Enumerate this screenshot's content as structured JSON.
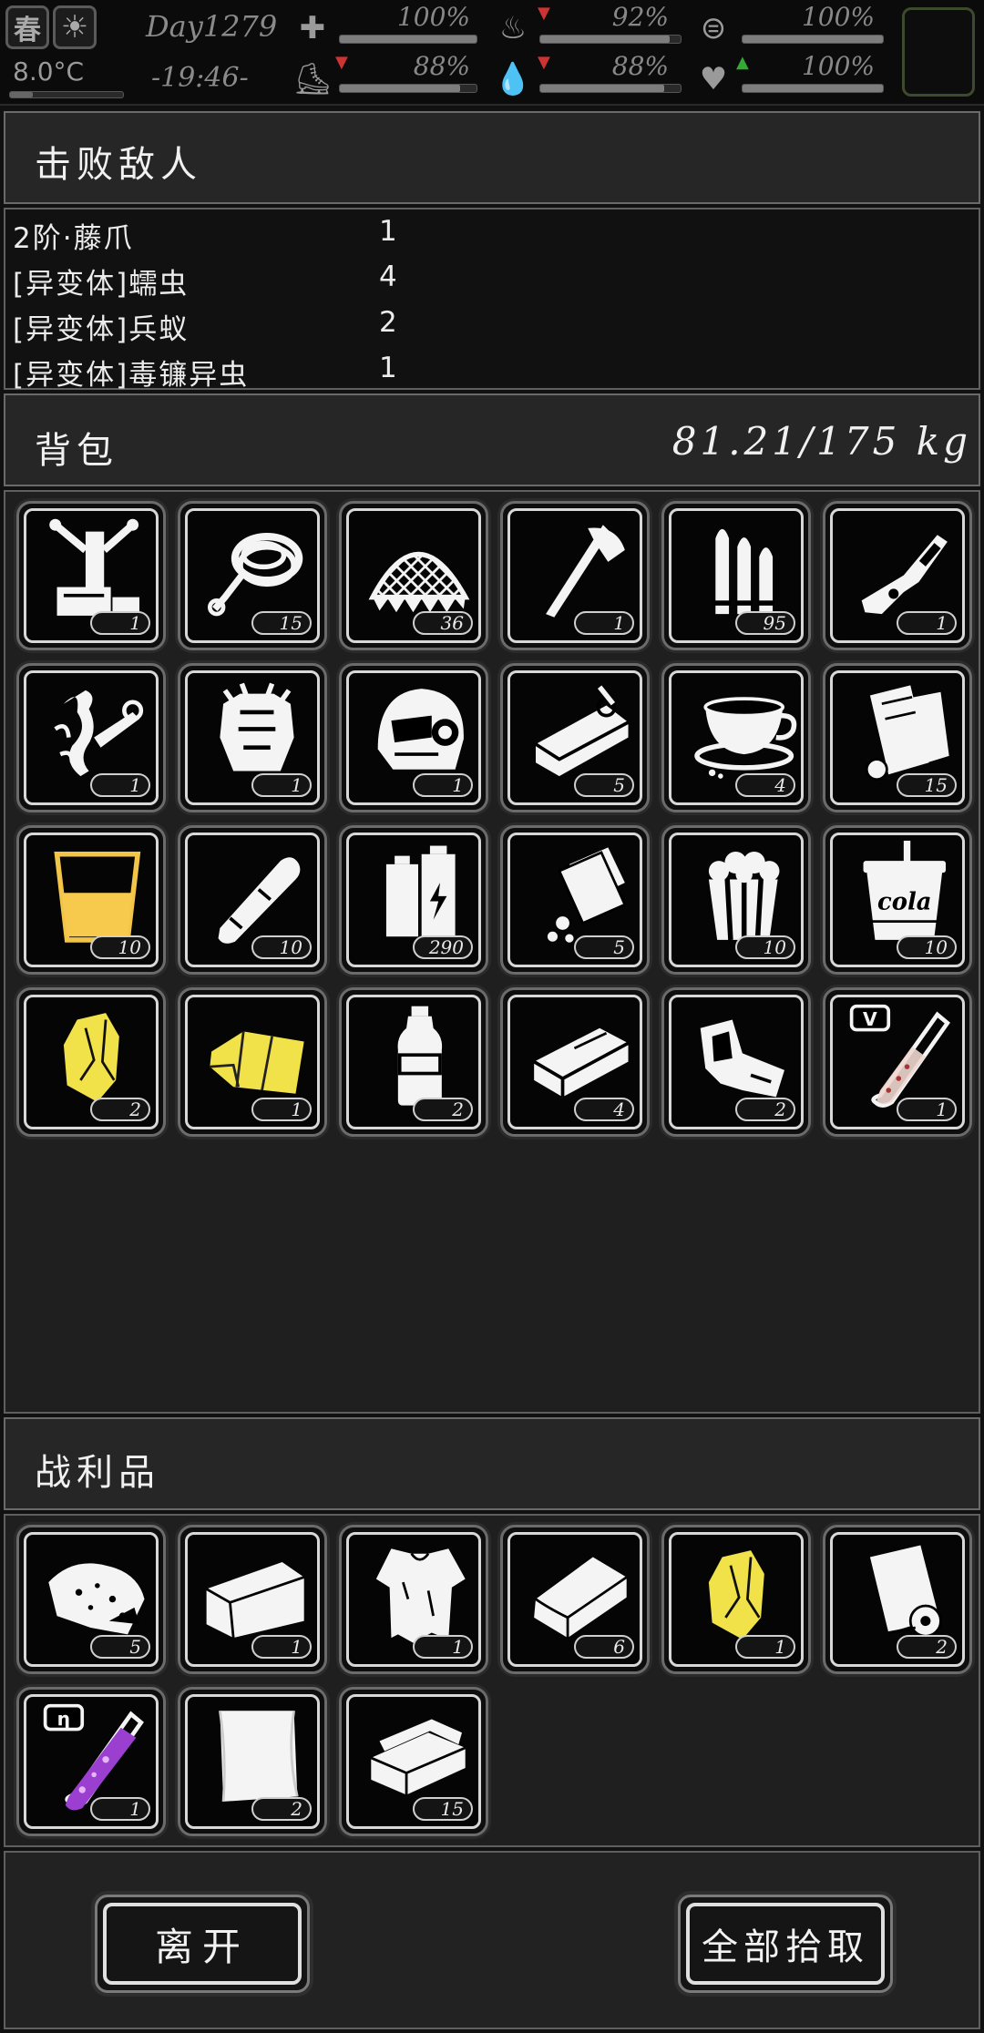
{
  "status": {
    "season": "春",
    "day": "Day1279",
    "temperature": "8.0°C",
    "time": "-19:46-",
    "stats": [
      {
        "icon": "medkit-icon",
        "value": "100%",
        "level": 1.0
      },
      {
        "icon": "stomach-icon",
        "value": "92%",
        "level": 0.92,
        "trend": "down"
      },
      {
        "icon": "stamina-icon",
        "value": "100%",
        "level": 1.0
      },
      {
        "icon": "boot-icon",
        "value": "88%",
        "level": 0.88,
        "trend": "down"
      },
      {
        "icon": "water-drop-icon",
        "value": "88%",
        "level": 0.88,
        "trend": "down"
      },
      {
        "icon": "heart-icon",
        "value": "100%",
        "level": 1.0,
        "trend": "up"
      }
    ]
  },
  "defeated": {
    "title": "击败敌人",
    "enemies": [
      {
        "name": "2阶·藤爪",
        "count": "1"
      },
      {
        "name": "[异变体]蠕虫",
        "count": "4"
      },
      {
        "name": "[异变体]兵蚁",
        "count": "2"
      },
      {
        "name": "[异变体]毒镰异虫",
        "count": "1"
      }
    ]
  },
  "backpack": {
    "title": "背包",
    "weight": "81.21/175 kg",
    "items": [
      {
        "icon": "workbench-icon",
        "count": "1"
      },
      {
        "icon": "rope-icon",
        "count": "15"
      },
      {
        "icon": "net-icon",
        "count": "36"
      },
      {
        "icon": "axe-icon",
        "count": "1"
      },
      {
        "icon": "bullets-icon",
        "count": "95"
      },
      {
        "icon": "rifle-icon",
        "count": "1"
      },
      {
        "icon": "vine-claw-icon",
        "count": "1"
      },
      {
        "icon": "armor-icon",
        "count": "1"
      },
      {
        "icon": "helmet-icon",
        "count": "1"
      },
      {
        "icon": "canned-fish-icon",
        "count": "5"
      },
      {
        "icon": "coffee-cup-icon",
        "count": "4"
      },
      {
        "icon": "paper-scroll-icon",
        "count": "15"
      },
      {
        "icon": "juice-cup-icon",
        "count": "10"
      },
      {
        "icon": "bandage-roll-icon",
        "count": "10"
      },
      {
        "icon": "battery-icon",
        "count": "290"
      },
      {
        "icon": "pill-bottle-icon",
        "count": "5"
      },
      {
        "icon": "popcorn-icon",
        "count": "10"
      },
      {
        "icon": "cola-cup-icon",
        "count": "10",
        "label": "cola"
      },
      {
        "icon": "yellow-crystal-icon",
        "count": "2",
        "color": "#f2e24a"
      },
      {
        "icon": "yellow-cloth-icon",
        "count": "1",
        "color": "#f2e24a"
      },
      {
        "icon": "water-bottle-icon",
        "count": "2"
      },
      {
        "icon": "bar-block-icon",
        "count": "4"
      },
      {
        "icon": "scrap-icon",
        "count": "2"
      },
      {
        "icon": "test-tube-v-icon",
        "count": "1",
        "label": "V"
      }
    ]
  },
  "loot": {
    "title": "战利品",
    "items": [
      {
        "icon": "seed-bag-icon",
        "count": "5"
      },
      {
        "icon": "folded-cloth-icon",
        "count": "1"
      },
      {
        "icon": "torn-shirt-icon",
        "count": "1"
      },
      {
        "icon": "fabric-icon",
        "count": "6"
      },
      {
        "icon": "yellow-crystal-icon",
        "count": "1",
        "color": "#f2e24a"
      },
      {
        "icon": "paper-roll-icon",
        "count": "2"
      },
      {
        "icon": "test-tube-eta-icon",
        "count": "1",
        "label": "η",
        "color": "#9b3fd0"
      },
      {
        "icon": "cloth-sheet-icon",
        "count": "2"
      },
      {
        "icon": "towel-stack-icon",
        "count": "15"
      }
    ]
  },
  "actions": {
    "leave": "离开",
    "take_all": "全部拾取"
  }
}
